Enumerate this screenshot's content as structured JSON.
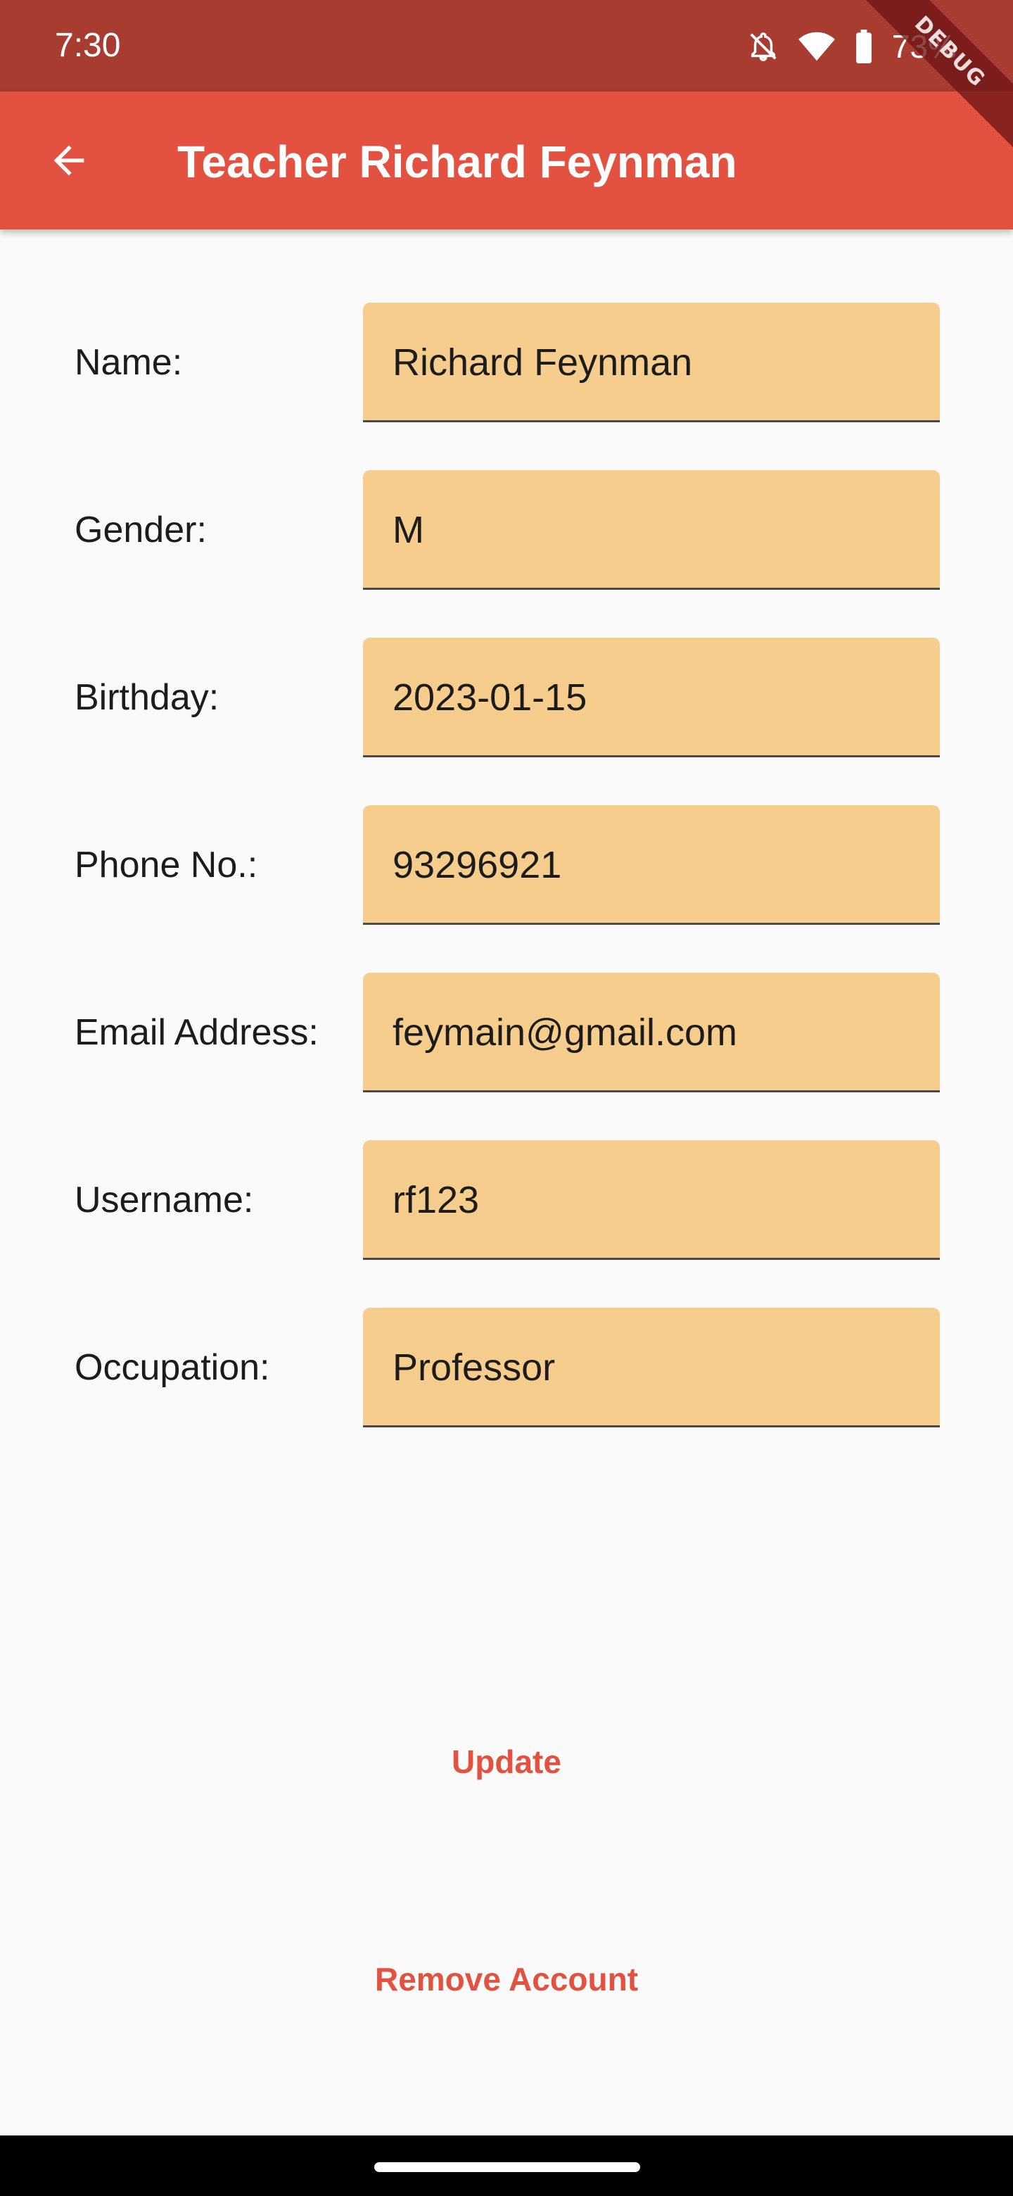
{
  "status_bar": {
    "time": "7:30",
    "battery": "73%",
    "icons": [
      "notifications-off-icon",
      "wifi-icon",
      "battery-icon"
    ]
  },
  "debug_banner": "DEBUG",
  "app_bar": {
    "back_icon": "arrow-back-icon",
    "title": "Teacher Richard Feynman"
  },
  "form": {
    "name": {
      "label": "Name:",
      "value": "Richard Feynman"
    },
    "gender": {
      "label": "Gender:",
      "value": "M"
    },
    "birthday": {
      "label": "Birthday:",
      "value": "2023-01-15"
    },
    "phone": {
      "label": "Phone No.:",
      "value": "93296921"
    },
    "email": {
      "label": "Email Address:",
      "value": "feymain@gmail.com"
    },
    "username": {
      "label": "Username:",
      "value": "rf123"
    },
    "occupation": {
      "label": "Occupation:",
      "value": "Professor"
    }
  },
  "actions": {
    "update": "Update",
    "remove": "Remove Account"
  },
  "colors": {
    "status_bar": "#a83c31",
    "app_bar": "#e35241",
    "field_fill": "#f7cd8d",
    "accent": "#e35241",
    "background": "#fafafa"
  }
}
